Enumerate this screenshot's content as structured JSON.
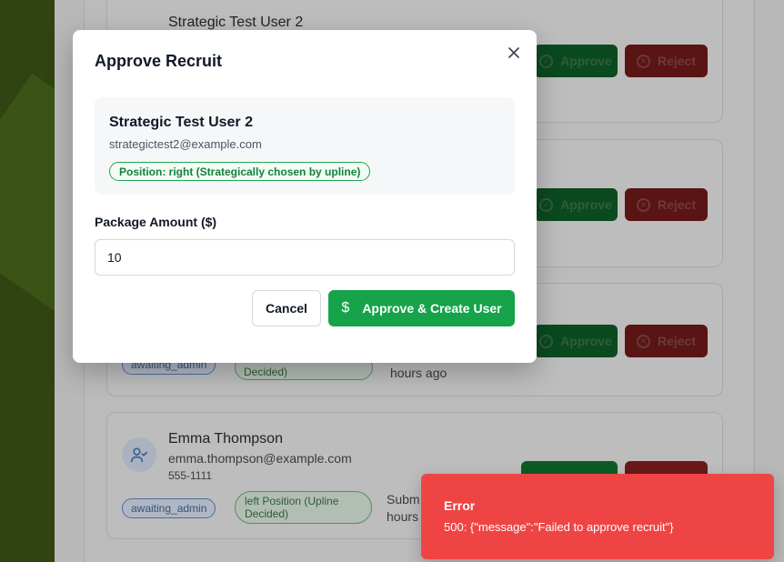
{
  "background": {
    "cards": [
      {
        "name": "Strategic Test User 2",
        "approve_label": "Approve",
        "reject_label": "Reject"
      },
      {
        "approve_label": "Approve",
        "reject_label": "Reject"
      },
      {
        "status": "awaiting_admin",
        "position": "Decided)",
        "submitted": "hours ago",
        "approve_label": "Approve",
        "reject_label": "Reject"
      },
      {
        "name": "Emma Thompson",
        "email": "emma.thompson@example.com",
        "phone": "555-1111",
        "status": "awaiting_admin",
        "position": "left Position (Upline Decided)",
        "submitted_line1": "Subm",
        "submitted_line2": "hours"
      }
    ]
  },
  "modal": {
    "title": "Approve Recruit",
    "recruit": {
      "name": "Strategic Test User 2",
      "email": "strategictest2@example.com",
      "position_badge": "Position: right (Strategically chosen by upline)"
    },
    "package_label": "Package Amount ($)",
    "package_value": "10",
    "cancel_label": "Cancel",
    "approve_label": "Approve & Create User"
  },
  "toast": {
    "title": "Error",
    "message": "500: {\"message\":\"Failed to approve recruit\"}"
  },
  "colors": {
    "approve_green": "#16a34a",
    "error_red": "#ef4444",
    "badge_green": "#15803d"
  }
}
